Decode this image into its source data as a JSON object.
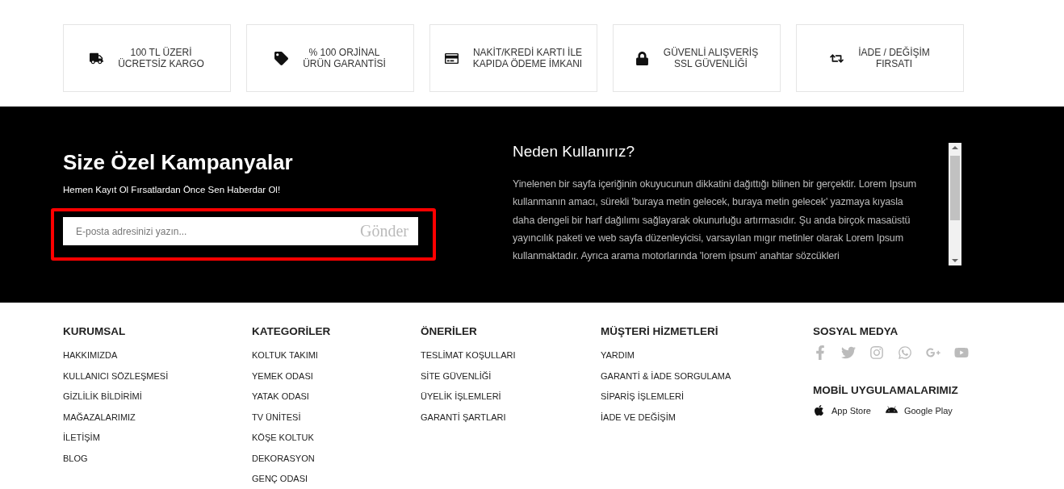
{
  "features": [
    {
      "lines": [
        "100 TL ÜZERİ",
        "ÜCRETSİZ KARGO"
      ]
    },
    {
      "lines": [
        "% 100 ORJİNAL",
        "ÜRÜN GARANTİSİ"
      ]
    },
    {
      "lines": [
        "NAKİT/KREDİ KARTI İLE",
        "KAPIDA ÖDEME İMKANI"
      ]
    },
    {
      "lines": [
        "GÜVENLİ ALIŞVERİŞ",
        "SSL GÜVENLİĞİ"
      ]
    },
    {
      "lines": [
        "İADE / DEĞİŞİM",
        "FIRSATI"
      ]
    }
  ],
  "newsletter": {
    "title": "Size Özel Kampanyalar",
    "subtitle": "Hemen Kayıt Ol Fırsatlardan Önce Sen Haberdar Ol!",
    "placeholder": "E-posta adresinizi yazın...",
    "button": "Gönder"
  },
  "about": {
    "title": "Neden Kullanırız?",
    "text": "Yinelenen bir sayfa içeriğinin okuyucunun dikkatini dağıttığı bilinen bir gerçektir. Lorem Ipsum kullanmanın amacı, sürekli 'buraya metin gelecek, buraya metin gelecek' yazmaya kıyasla daha dengeli bir harf dağılımı sağlayarak okunurluğu artırmasıdır. Şu anda birçok masaüstü yayıncılık paketi ve web sayfa düzenleyicisi, varsayılan mıgır metinler olarak Lorem Ipsum kullanmaktadır. Ayrıca arama motorlarında 'lorem ipsum' anahtar sözcükleri"
  },
  "footer_columns": [
    {
      "title": "KURUMSAL",
      "links": [
        "HAKKIMIZDA",
        "KULLANICI SÖZLEŞMESİ",
        "GİZLİLİK BİLDİRİMİ",
        "MAĞAZALARIMIZ",
        "İLETİŞİM",
        "BLOG"
      ]
    },
    {
      "title": "KATEGORİLER",
      "links": [
        "KOLTUK TAKIMI",
        "YEMEK ODASI",
        "YATAK ODASI",
        "TV ÜNİTESİ",
        "KÖŞE KOLTUK",
        "DEKORASYON",
        "GENÇ ODASI"
      ]
    },
    {
      "title": "ÖNERİLER",
      "links": [
        "TESLİMAT KOŞULLARI",
        "SİTE GÜVENLİĞİ",
        "ÜYELİK İŞLEMLERİ",
        "GARANTİ ŞARTLARI"
      ]
    },
    {
      "title": "MÜŞTERİ HİZMETLERİ",
      "links": [
        "YARDIM",
        "GARANTİ & İADE SORGULAMA",
        "SİPARİŞ İŞLEMLERİ",
        "İADE VE DEĞİŞİM"
      ]
    }
  ],
  "social": {
    "title": "SOSYAL MEDYA"
  },
  "apps": {
    "title": "MOBİL UYGULAMALARIMIZ",
    "stores": [
      "App Store",
      "Google Play"
    ]
  }
}
